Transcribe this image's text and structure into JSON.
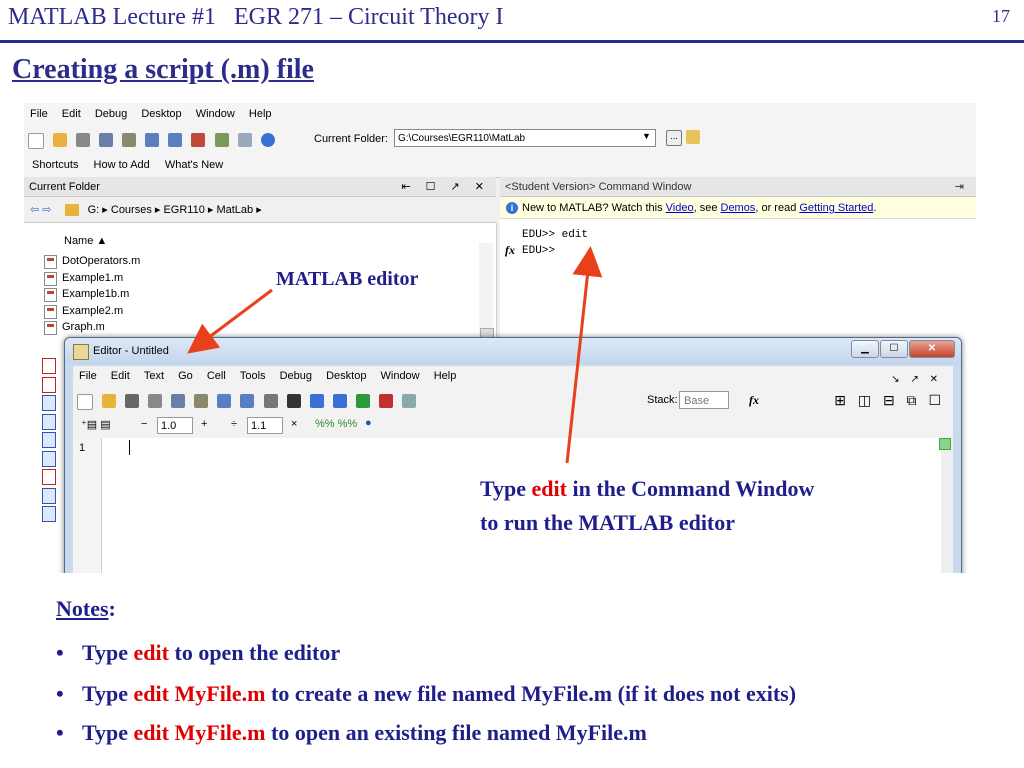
{
  "slide": {
    "header": "MATLAB Lecture #1   EGR 271 – Circuit Theory I",
    "number": "17",
    "title": "Creating a script (.m) file"
  },
  "matlab": {
    "menu": [
      "File",
      "Edit",
      "Debug",
      "Desktop",
      "Window",
      "Help"
    ],
    "current_folder_label": "Current Folder:",
    "current_folder_path": "G:\\Courses\\EGR110\\MatLab",
    "shortcuts": [
      "Shortcuts",
      "How to Add",
      "What's New"
    ],
    "current_folder_panel": "Current Folder",
    "breadcrumb": "G:  ▸  Courses  ▸  EGR110  ▸  MatLab  ▸",
    "name_header": "Name ▲",
    "files": [
      "DotOperators.m",
      "Example1.m",
      "Example1b.m",
      "Example2.m",
      "Graph.m"
    ],
    "command_window_title": "<Student Version> Command Window",
    "info": {
      "text1": "New to MATLAB? Watch this ",
      "video": "Video",
      "text2": ", see ",
      "demos": "Demos",
      "text3": ", or read ",
      "getting_started": "Getting Started",
      "text4": "."
    },
    "cmd_lines": [
      "EDU>> edit",
      "EDU>>"
    ],
    "fx": "fx"
  },
  "editor": {
    "title": "Editor - Untitled",
    "menu": [
      "File",
      "Edit",
      "Text",
      "Go",
      "Cell",
      "Tools",
      "Debug",
      "Desktop",
      "Window",
      "Help"
    ],
    "stack_label": "Stack:",
    "stack_value": "Base",
    "cell_value_1": "1.0",
    "cell_value_2": "1.1",
    "line_number": "1"
  },
  "annotations": {
    "editor_label": "MATLAB editor",
    "type_prefix": "Type ",
    "type_edit": "edit",
    "type_suffix": "  in the Command Window",
    "type_line2": "to run the MATLAB editor"
  },
  "notes": {
    "heading": "Notes",
    "colon": ":",
    "bullets": [
      {
        "prefix": "Type ",
        "red": "edit",
        "suffix": " to open the editor"
      },
      {
        "prefix": "Type ",
        "red": "edit MyFile.m",
        "suffix": " to create a new file named MyFile.m (if it does not exits)"
      },
      {
        "prefix": "Type ",
        "red": "edit MyFile.m",
        "suffix": " to open an existing file named MyFile.m"
      }
    ]
  },
  "colors": {
    "header_blue": "#2b2c8c",
    "accent_red": "#e00000",
    "arrow_red": "#e8401a"
  }
}
